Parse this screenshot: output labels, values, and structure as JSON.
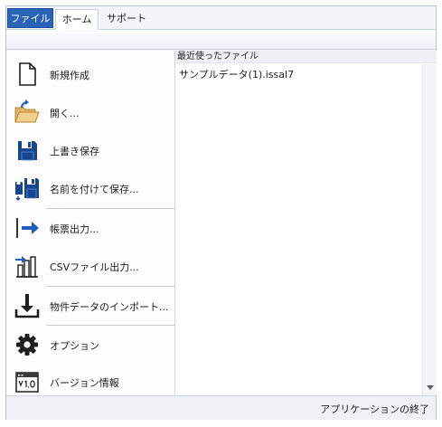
{
  "tabs": {
    "file": "ファイル",
    "home": "ホーム",
    "support": "サポート"
  },
  "menu": {
    "items": [
      {
        "label": "新規作成",
        "icon": "new-document-icon"
      },
      {
        "label": "開く...",
        "icon": "open-folder-icon"
      },
      {
        "label": "上書き保存",
        "icon": "save-icon"
      },
      {
        "label": "名前を付けて保存...",
        "icon": "save-as-icon"
      },
      {
        "label": "帳票出力...",
        "icon": "export-arrow-icon"
      },
      {
        "label": "CSVファイル出力...",
        "icon": "csv-export-icon"
      },
      {
        "label": "物件データのインポート...",
        "icon": "import-download-icon"
      },
      {
        "label": "オプション",
        "icon": "gear-icon"
      },
      {
        "label": "バージョン情報",
        "icon": "version-info-icon"
      }
    ]
  },
  "recent": {
    "header": "最近使ったファイル",
    "files": [
      "サンプルデータ(1).issal7"
    ]
  },
  "footer": {
    "exit_label": "アプリケーションの終了"
  },
  "colors": {
    "file_tab": "#2a64b8",
    "accent_blue": "#1f5fbf"
  }
}
